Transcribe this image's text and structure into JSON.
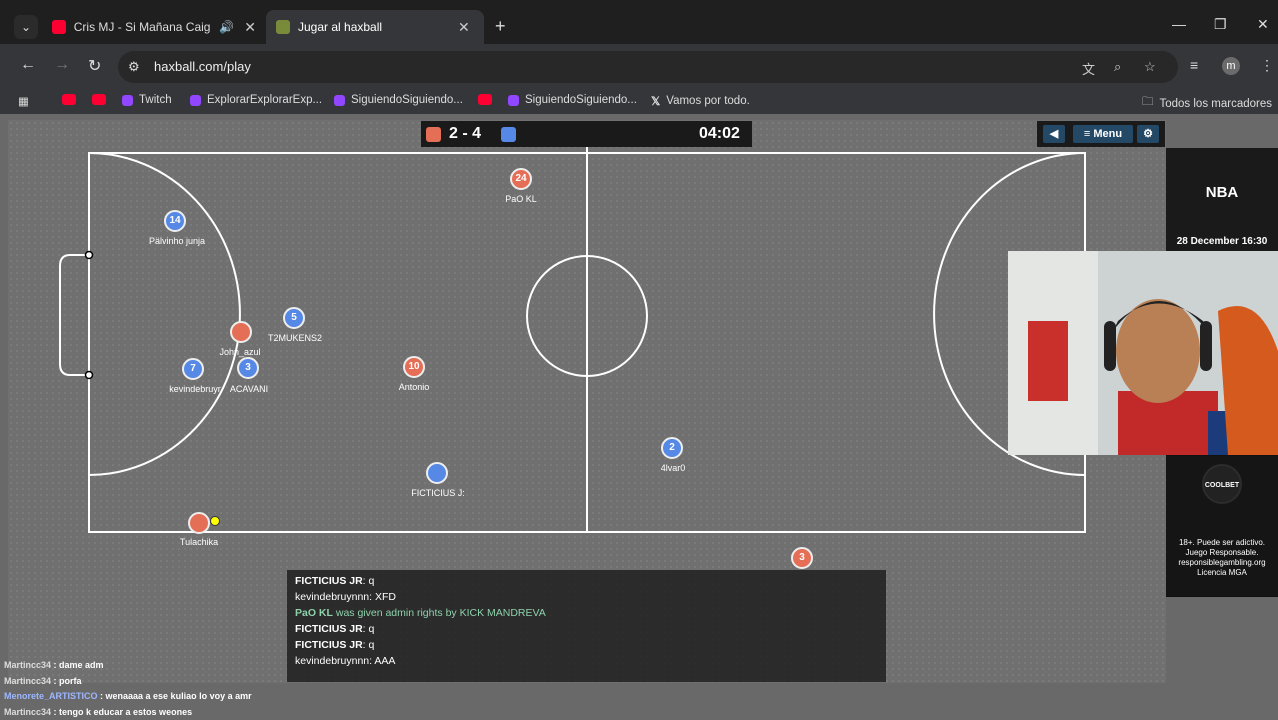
{
  "browser": {
    "tabs": [
      {
        "title": "Cris MJ - Si Mañana Caigo (",
        "favicon": "youtube-icon",
        "audio": true
      },
      {
        "title": "Jugar al haxball",
        "favicon": "haxball-icon",
        "active": true
      }
    ],
    "url": "haxball.com/play",
    "bookmarks": [
      {
        "label": "",
        "icon": "youtube-icon"
      },
      {
        "label": "",
        "icon": "youtube-icon"
      },
      {
        "label": "Twitch",
        "icon": "twitch-icon"
      },
      {
        "label": "ExplorarExplorarExp...",
        "icon": "twitch-icon"
      },
      {
        "label": "SiguiendoSiguiendo...",
        "icon": "twitch-icon"
      },
      {
        "label": "",
        "icon": "youtube-icon"
      },
      {
        "label": "SiguiendoSiguiendo...",
        "icon": "twitch-icon"
      },
      {
        "label": "Vamos por todo.",
        "icon": "x-icon"
      }
    ],
    "all_bookmarks": "Todos los marcadores",
    "avatar_letter": "m"
  },
  "game": {
    "score_red": "2",
    "score_sep": "-",
    "score_blue": "4",
    "score_text": "2 - 4",
    "time": "04:02",
    "menu_label": "Menu",
    "colors": {
      "red": "#e56e56",
      "blue": "#5689e5",
      "field": "#707070"
    },
    "players": [
      {
        "team": "red",
        "number": "24",
        "name": "PaO KL"
      },
      {
        "team": "blue",
        "number": "14",
        "name": "Pälvinho junja"
      },
      {
        "team": "blue",
        "number": "5",
        "name": "T2MUKENS2"
      },
      {
        "team": "red",
        "number": "",
        "name": "John_azul"
      },
      {
        "team": "blue",
        "number": "7",
        "name": "kevindebruyr"
      },
      {
        "team": "blue",
        "number": "3",
        "name": "ACAVANI"
      },
      {
        "team": "red",
        "number": "10",
        "name": "Antonio"
      },
      {
        "team": "blue",
        "number": "2",
        "name": "4lvar0"
      },
      {
        "team": "blue",
        "number": "",
        "name": "FICTICIUS J:"
      },
      {
        "team": "red",
        "number": "",
        "name": "Tulachika"
      },
      {
        "team": "red",
        "number": "3",
        "name": ""
      }
    ],
    "chat": [
      {
        "user": "FICTICIUS JR",
        "text": ": q"
      },
      {
        "user": "kevindebruynnn",
        "text": ": XFD"
      },
      {
        "user": "PaO KL",
        "text": " was given admin rights by KICK MANDREVA",
        "admin": true
      },
      {
        "user": "FICTICIUS JR",
        "text": ": q"
      },
      {
        "user": "FICTICIUS JR",
        "text": ": q"
      },
      {
        "user": "kevindebruynnn",
        "text": ": AAA"
      }
    ]
  },
  "stream_chat": [
    {
      "user": "Martincc34",
      "text": " : dame adm"
    },
    {
      "user": "Martincc34",
      "text": " : porfa"
    },
    {
      "user": "Menorete_ARTISTICO",
      "text": " : wenaaaa a ese kuliao lo voy a amr"
    },
    {
      "user": "Martincc34",
      "text": " : tengo k educar a estos weones"
    }
  ],
  "ads": {
    "nba_title": "NBA",
    "nba_date": "28 December 16:30",
    "coolbet_logo": "COOLBET",
    "legal": "18+. Puede ser adictivo. Juego Responsable. responsiblegambling.org Licencia MGA"
  }
}
